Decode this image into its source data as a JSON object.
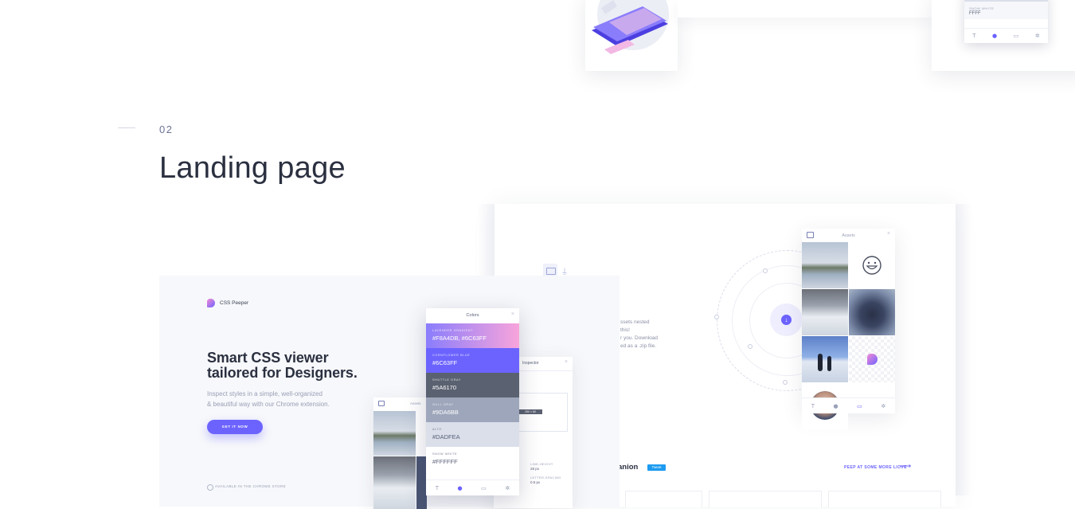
{
  "section": {
    "number": "02",
    "title": "Landing page"
  },
  "top_panel": {
    "swatch_name": "SNOW WHITE",
    "swatch_hex": "FFFF"
  },
  "landing": {
    "brand": "CSS Peeper",
    "headline_1": "Smart CSS viewer",
    "headline_2": "tailored for Designers.",
    "sub_1": "Inspect styles in a simple, well-organized",
    "sub_2": "& beautiful way with our Chrome extension.",
    "cta": "GET IT NOW",
    "store_note": "AVAILABLE IN THE CHROME STORE"
  },
  "colors_panel": {
    "title": "Colors",
    "swatches": [
      {
        "name": "LAVENDER GRADIENT",
        "hex": "#F8A4DB, #6C63FF"
      },
      {
        "name": "CORNFLOWER BLUE",
        "hex": "#6C63FF"
      },
      {
        "name": "SHUTTLE GRAY",
        "hex": "#5A6170"
      },
      {
        "name": "GULL GRAY",
        "hex": "#9DA6BB"
      },
      {
        "name": "ALTO",
        "hex": "#DADFEA"
      },
      {
        "name": "SNOW WHITE",
        "hex": "#FFFFFF"
      }
    ]
  },
  "inspector_panel": {
    "title": "Inspector",
    "size": "250 × 60",
    "line_height_label": "LINE-HEIGHT",
    "line_height_value": "28 px",
    "letter_spacing_label": "LETTER-SPACING",
    "letter_spacing_value": "0.5 px"
  },
  "assets_panel": {
    "title": "Assets"
  },
  "feature_text": {
    "l1": "ssets nested",
    "l2": "this!",
    "l3": "r you. Download",
    "l4": "ed as a .zip file."
  },
  "footer": {
    "companion": "anion",
    "tweet": "Tweet",
    "peep": "PEEP AT SOME MORE LIOVE"
  },
  "colors": {
    "accent": "#6C63FF",
    "gradient_start": "#F8A4DB"
  }
}
